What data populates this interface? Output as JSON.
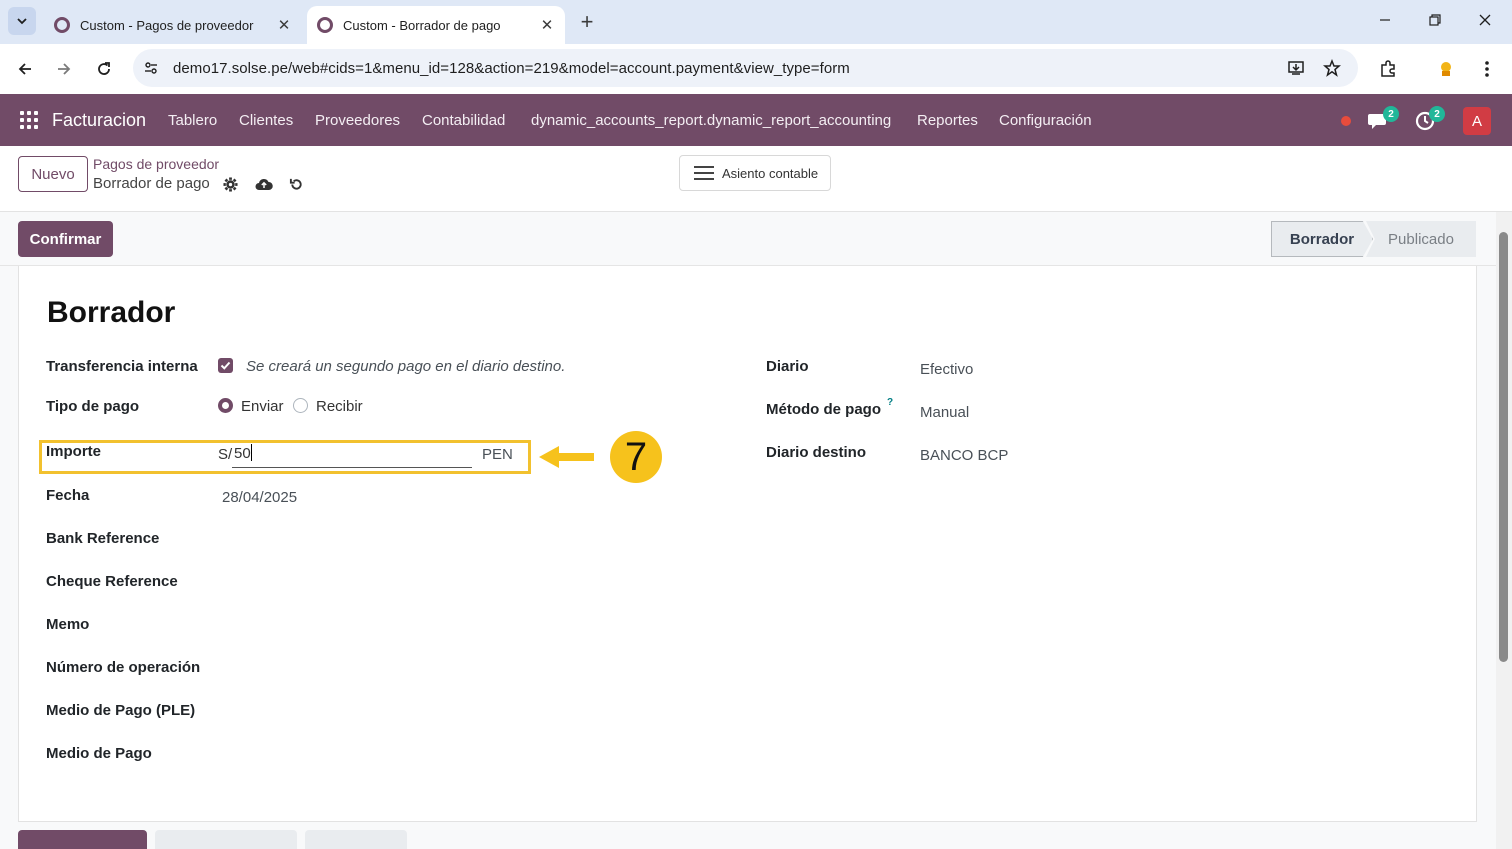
{
  "browser": {
    "tabs": [
      {
        "title": "Custom - Pagos de proveedor",
        "active": false
      },
      {
        "title": "Custom - Borrador de pago",
        "active": true
      }
    ],
    "url": "demo17.solse.pe/web#cids=1&menu_id=128&action=219&model=account.payment&view_type=form"
  },
  "navbar": {
    "app_name": "Facturacion",
    "menu": [
      "Tablero",
      "Clientes",
      "Proveedores",
      "Contabilidad",
      "dynamic_accounts_report.dynamic_report_accounting",
      "Reportes",
      "Configuración"
    ],
    "messages_count": "2",
    "activities_count": "2",
    "avatar_letter": "A",
    "accent_color": "#714b67"
  },
  "control_panel": {
    "new_label": "Nuevo",
    "breadcrumb_parent": "Pagos de proveedor",
    "breadcrumb_current": "Borrador de pago",
    "journal_entry_label": "Asiento contable"
  },
  "statusbar": {
    "confirm_label": "Confirmar",
    "states": [
      "Borrador",
      "Publicado"
    ],
    "current_state": "Borrador"
  },
  "form": {
    "title": "Borrador",
    "internal_transfer": {
      "label": "Transferencia interna",
      "checked": true,
      "hint": "Se creará un segundo pago en el diario destino."
    },
    "payment_type": {
      "label": "Tipo de pago",
      "options": [
        "Enviar",
        "Recibir"
      ],
      "selected": "Enviar"
    },
    "amount": {
      "label": "Importe",
      "symbol": "S/",
      "value": "50",
      "currency": "PEN"
    },
    "date": {
      "label": "Fecha",
      "value": "28/04/2025"
    },
    "bank_reference": {
      "label": "Bank Reference"
    },
    "cheque_reference": {
      "label": "Cheque Reference"
    },
    "memo": {
      "label": "Memo"
    },
    "operation_number": {
      "label": "Número de operación"
    },
    "payment_medium_ple": {
      "label": "Medio de Pago (PLE)"
    },
    "payment_medium": {
      "label": "Medio de Pago"
    },
    "journal": {
      "label": "Diario",
      "value": "Efectivo"
    },
    "payment_method": {
      "label": "Método de pago",
      "help": "?",
      "value": "Manual"
    },
    "destination_journal": {
      "label": "Diario destino",
      "value": "BANCO BCP"
    }
  },
  "annotation": {
    "step_number": "7",
    "color": "#f6c21c"
  }
}
